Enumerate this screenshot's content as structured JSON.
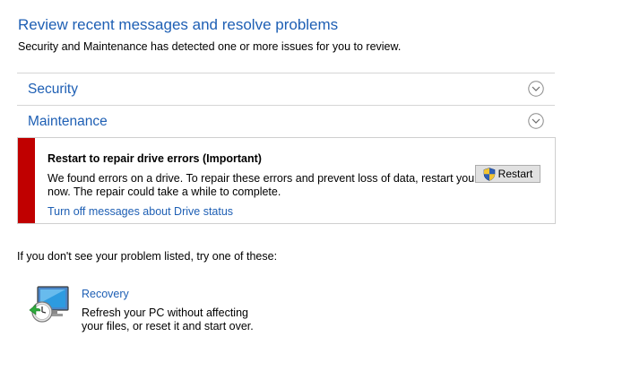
{
  "header": {
    "title": "Review recent messages and resolve problems",
    "subtitle": "Security and Maintenance has detected one or more issues for you to review."
  },
  "sections": {
    "security": {
      "label": "Security",
      "icon": "chevron-down-circle-icon"
    },
    "maintenance": {
      "label": "Maintenance",
      "icon": "chevron-down-circle-icon"
    }
  },
  "alert": {
    "severity_color": "#c00000",
    "title": "Restart to repair drive errors  (Important)",
    "description_line1": "We found errors on a drive. To repair these errors and prevent loss of data, restart your PC",
    "description_line2": "now. The repair could take a while to complete.",
    "link": "Turn off messages about Drive status",
    "button_label": "Restart",
    "button_icon": "uac-shield-icon"
  },
  "fallback": {
    "text": "If you don't see your problem listed, try one of these:"
  },
  "recovery": {
    "link": "Recovery",
    "description_line1": "Refresh your PC without affecting",
    "description_line2": "your files, or reset it and start over.",
    "icon": "recovery-pc-icon"
  },
  "colors": {
    "link_blue": "#1e5fb4",
    "alert_red": "#c00000"
  }
}
